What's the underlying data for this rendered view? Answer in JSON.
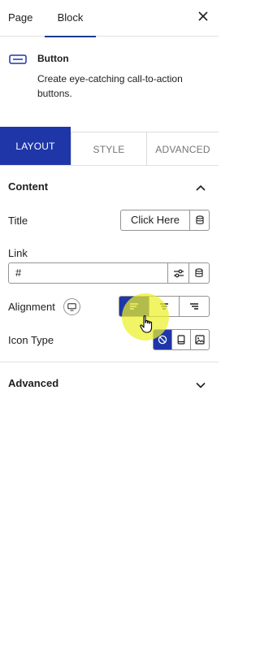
{
  "tabs": {
    "page": "Page",
    "block": "Block"
  },
  "block": {
    "icon": "button-icon",
    "name": "Button",
    "description": "Create eye-catching call-to-action buttons."
  },
  "section_tabs": {
    "layout": "LAYOUT",
    "style": "STYLE",
    "advanced": "ADVANCED",
    "active": "LAYOUT"
  },
  "content_panel": {
    "title": "Content",
    "title_label": "Title",
    "title_value": "Click Here",
    "link_label": "Link",
    "link_value": "#",
    "alignment_label": "Alignment",
    "alignment_options": [
      "left",
      "center",
      "right"
    ],
    "alignment_selected": "left",
    "icon_type_label": "Icon Type",
    "icon_type_options": [
      "none",
      "icon",
      "image"
    ],
    "icon_type_selected": "none"
  },
  "advanced_panel": {
    "title": "Advanced"
  },
  "colors": {
    "accent": "#1e36a8",
    "highlight": "#ecf028",
    "border": "#949494"
  }
}
